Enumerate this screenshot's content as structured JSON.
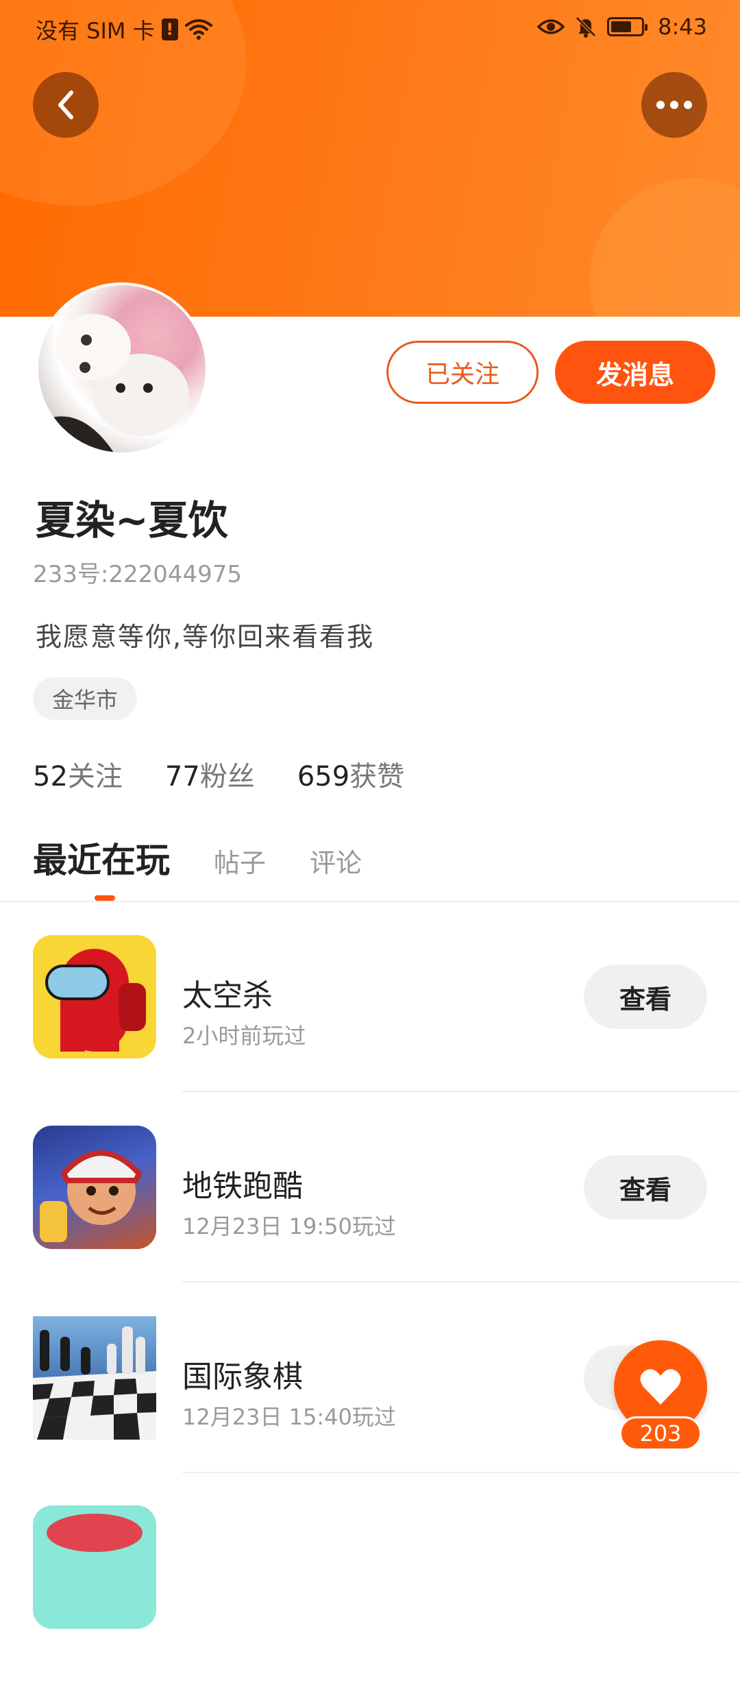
{
  "status_bar": {
    "carrier": "没有 SIM 卡",
    "time": "8:43",
    "icons": [
      "sim-alert-icon",
      "wifi-icon",
      "eye-icon",
      "bell-off-icon",
      "battery-icon"
    ]
  },
  "header": {
    "back_icon": "chevron-left-icon",
    "more_icon": "more-dots-icon",
    "banner_color": "#ff7a1a"
  },
  "profile": {
    "follow_label": "已关注",
    "message_label": "发消息",
    "nickname": "夏染~夏饮",
    "user_id": "233号:222044975",
    "bio": "我愿意等你,等你回来看看我",
    "location": "金华市",
    "stats": [
      {
        "num": "52",
        "label": "关注"
      },
      {
        "num": "77",
        "label": "粉丝"
      },
      {
        "num": "659",
        "label": "获赞"
      }
    ]
  },
  "tabs": [
    {
      "label": "最近在玩",
      "active": true
    },
    {
      "label": "帖子",
      "active": false
    },
    {
      "label": "评论",
      "active": false
    }
  ],
  "games": [
    {
      "name": "太空杀",
      "time": "2小时前玩过",
      "button": "查看"
    },
    {
      "name": "地铁跑酷",
      "time": "12月23日 19:50玩过",
      "button": "查看"
    },
    {
      "name": "国际象棋",
      "time": "12月23日 15:40玩过",
      "button": "查看"
    }
  ],
  "like": {
    "count": "203",
    "icon": "heart-icon"
  },
  "colors": {
    "accent": "#ff5410",
    "muted": "#9a9a9a"
  }
}
